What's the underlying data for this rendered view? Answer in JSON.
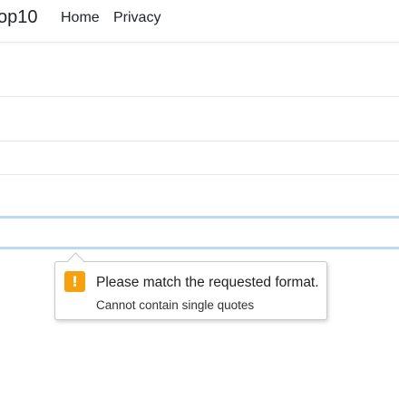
{
  "navbar": {
    "brand": "op10",
    "links": [
      "Home",
      "Privacy"
    ]
  },
  "validation": {
    "title": "Please match the requested format.",
    "detail": "Cannot contain single quotes",
    "icon": "warning-exclamation-icon",
    "icon_glyph": "!",
    "icon_color": "#f7a10f"
  },
  "focus_color": "#bcd8f3"
}
